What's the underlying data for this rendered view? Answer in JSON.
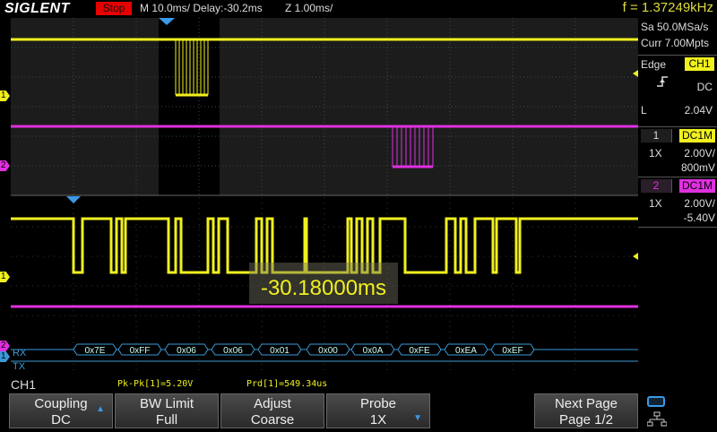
{
  "topbar": {
    "brand": "SIGLENT",
    "run_state": "Stop",
    "timebase": "M 10.0ms/ Delay:-30.2ms",
    "zoom": "Z 1.00ms/",
    "frequency": "f = 1.37249kHz"
  },
  "right_panel": {
    "sample_rate": "Sa 50.0MSa/s",
    "memory": "Curr 7.00Mpts",
    "trigger": {
      "type": "Edge",
      "source": "CH1",
      "coupling": "DC",
      "level_prefix": "L",
      "level": "2.04V"
    },
    "ch1": {
      "number": "1",
      "coupling_badge": "DC1M",
      "probe": "1X",
      "scale": "2.00V/",
      "offset": "800mV"
    },
    "ch2": {
      "number": "2",
      "coupling_badge": "DC1M",
      "probe": "1X",
      "scale": "2.00V/",
      "offset": "-5.40V"
    }
  },
  "screen": {
    "delay_readout": "-30.18000ms",
    "decode": {
      "rx_label": "RX",
      "tx_label": "TX",
      "rx_bytes": [
        "0x7E",
        "0xFF",
        "0x06",
        "0x06",
        "0x01",
        "0x00",
        "0x0A",
        "0xFE",
        "0xEA",
        "0xEF"
      ]
    },
    "markers": {
      "ch1_main": "1",
      "ch2_main": "2",
      "ch1_zoom": "1",
      "ch2_zoom": "2",
      "bus": "1"
    }
  },
  "measure": {
    "active_channel": "CH1",
    "pkpk": "Pk-Pk[1]=5.20V",
    "period": "Prd[1]=549.34us"
  },
  "softkeys": [
    {
      "title": "Coupling",
      "value": "DC"
    },
    {
      "title": "BW Limit",
      "value": "Full"
    },
    {
      "title": "Adjust",
      "value": "Coarse"
    },
    {
      "title": "Probe",
      "value": "1X"
    },
    {
      "title": "Next Page",
      "value": "Page 1/2"
    }
  ],
  "colors": {
    "ch1": "#f0f01e",
    "ch2": "#e030e0",
    "decode": "#3a9ad8",
    "accent": "#3a9ae8",
    "stop": "#e60000"
  }
}
